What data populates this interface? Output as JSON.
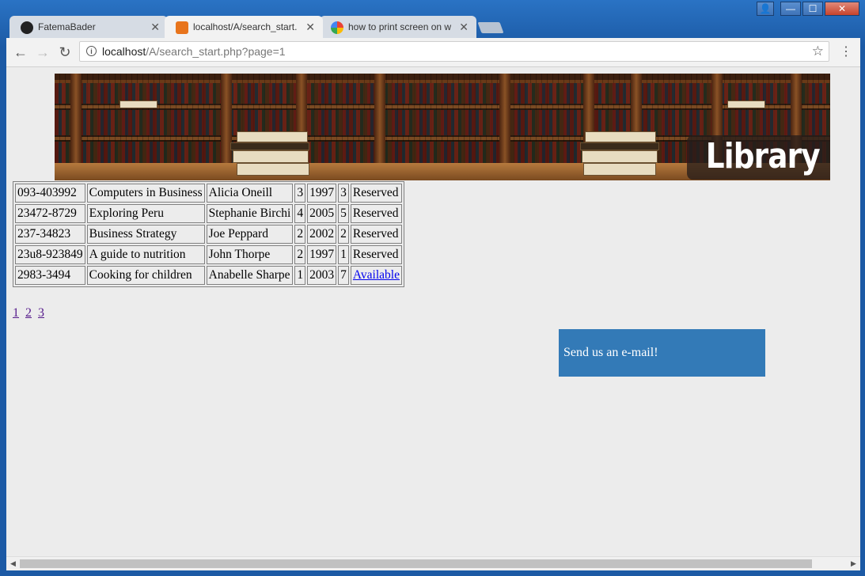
{
  "window": {
    "controls": {
      "user": "👤",
      "minimize": "—",
      "maximize": "☐",
      "close": "✕"
    }
  },
  "tabs": [
    {
      "title": "FatemaBader",
      "icon": "github-icon",
      "active": false
    },
    {
      "title": "localhost/A/search_start.",
      "icon": "xampp-icon",
      "active": true
    },
    {
      "title": "how to print screen on w",
      "icon": "google-icon",
      "active": false
    }
  ],
  "toolbar": {
    "back": "←",
    "forward": "→",
    "reload": "↻",
    "url_host": "localhost",
    "url_path": "/A/search_start.php?page=1",
    "star": "☆",
    "menu": "⋮"
  },
  "banner": {
    "label": "Library"
  },
  "results": {
    "rows": [
      {
        "isbn": "093-403992",
        "title": "Computers in Business",
        "author": "Alicia Oneill",
        "c1": "3",
        "year": "1997",
        "c2": "3",
        "status": "Reserved",
        "link": false
      },
      {
        "isbn": "23472-8729",
        "title": "Exploring Peru",
        "author": "Stephanie Birchi",
        "c1": "4",
        "year": "2005",
        "c2": "5",
        "status": "Reserved",
        "link": false
      },
      {
        "isbn": "237-34823",
        "title": "Business Strategy",
        "author": "Joe Peppard",
        "c1": "2",
        "year": "2002",
        "c2": "2",
        "status": "Reserved",
        "link": false
      },
      {
        "isbn": "23u8-923849",
        "title": "A guide to nutrition",
        "author": "John Thorpe",
        "c1": "2",
        "year": "1997",
        "c2": "1",
        "status": "Reserved",
        "link": false
      },
      {
        "isbn": "2983-3494",
        "title": "Cooking for children",
        "author": "Anabelle Sharpe",
        "c1": "1",
        "year": "2003",
        "c2": "7",
        "status": "Available",
        "link": true
      }
    ]
  },
  "pager": {
    "pages": [
      "1",
      "2",
      "3"
    ]
  },
  "contact": {
    "label": "Send us an e-mail!"
  }
}
